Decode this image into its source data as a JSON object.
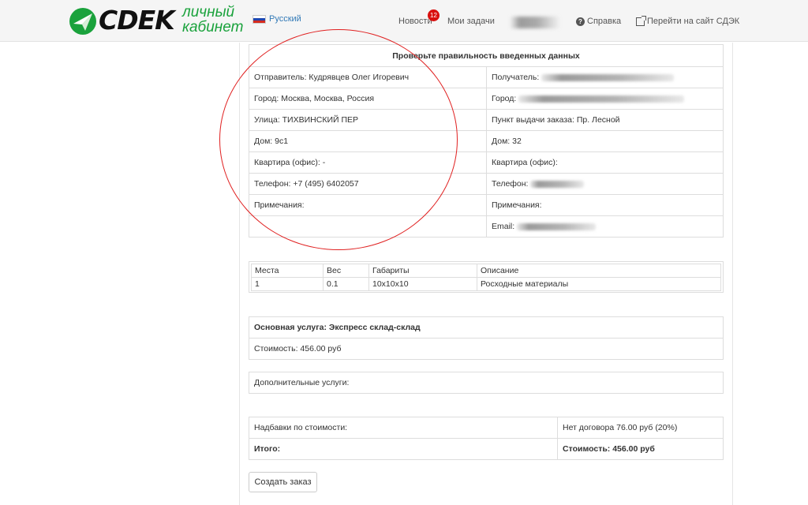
{
  "header": {
    "brand": "CDEK",
    "brand_sub_line1": "личный",
    "brand_sub_line2": "кабинет",
    "language": "Русский",
    "nav": {
      "news": "Новости",
      "news_badge": "12",
      "tasks": "Мои задачи",
      "help": "Справка",
      "go_to_site": "Перейти на сайт СДЭК"
    }
  },
  "confirm": {
    "title": "Проверьте правильность введенных данных",
    "sender": {
      "name": "Отправитель: Кудрявцев Олег Игоревич",
      "city": "Город: Москва, Москва, Россия",
      "street": "Улица: ТИХВИНСКИЙ ПЕР",
      "house": "Дом: 9с1",
      "apartment": "Квартира (офис): -",
      "phone": "Телефон: +7 (495) 6402057",
      "notes": "Примечания:"
    },
    "recipient": {
      "name_label": "Получатель:",
      "city_label": "Город:",
      "pickup": "Пункт выдачи заказа: Пр. Лесной",
      "house": "Дом: 32",
      "apartment": "Квартира (офис):",
      "phone_label": "Телефон:",
      "notes": "Примечания:",
      "email_label": "Email:"
    }
  },
  "items": {
    "headers": [
      "Места",
      "Вес",
      "Габариты",
      "Описание"
    ],
    "rows": [
      [
        "1",
        "0.1",
        "10x10x10",
        "Росходные материалы"
      ]
    ]
  },
  "service": {
    "main": "Основная услуга: Экспресс склад-склад",
    "cost": "Стоимость: 456.00 руб",
    "additional": "Дополнительные услуги:"
  },
  "totals": {
    "surcharge_label": "Надбавки по стоимости:",
    "surcharge_value": "Нет договора 76.00 руб (20%)",
    "total_label": "Итого:",
    "total_value": "Стоимость: 456.00 руб"
  },
  "actions": {
    "create_order": "Создать заказ"
  },
  "colors": {
    "brand_green": "#1aa23c",
    "annotation_red": "#e02020",
    "badge_red": "#d9100e",
    "link_blue": "#337ab7"
  }
}
